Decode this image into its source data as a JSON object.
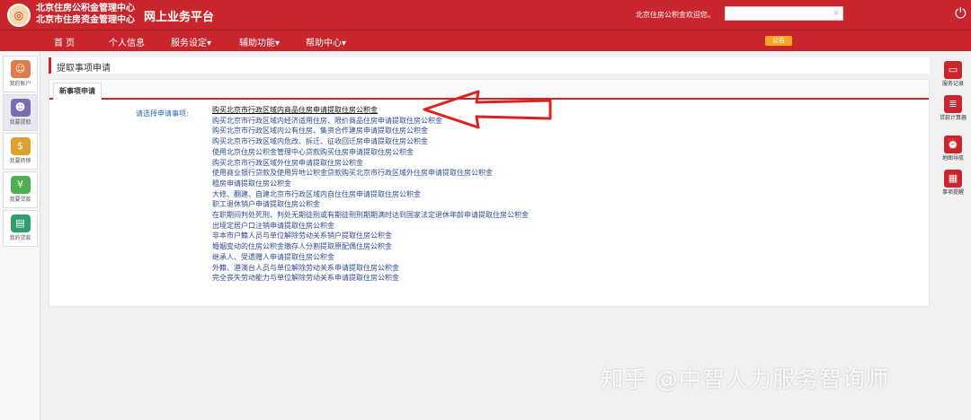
{
  "header": {
    "org_line1": "北京住房公积金管理中心",
    "org_line2": "北京市住房资金管理中心",
    "platform_title": "网上业务平台",
    "welcome": "北京住房公积金欢迎您。",
    "search_value": ""
  },
  "nav": {
    "items": [
      "首 页",
      "个人信息",
      "服务设定▾",
      "辅助功能▾",
      "帮助中心▾"
    ],
    "badge": "公告"
  },
  "leftbar": {
    "items": [
      {
        "label": "我的账户"
      },
      {
        "label": "我要提取"
      },
      {
        "label": "我要转移"
      },
      {
        "label": "我要贷款"
      },
      {
        "label": "我的贷款"
      }
    ]
  },
  "rightbar": {
    "items": [
      {
        "label": "服务记录"
      },
      {
        "label": "贷款计算器"
      },
      {
        "label": "地图导航"
      },
      {
        "label": "事项提醒"
      }
    ]
  },
  "main": {
    "breadcrumb": "提取事项申请",
    "tab": "新事项申请",
    "select_label": "请选择申请事项:",
    "options": [
      "购买北京市行政区域内商品住房申请提取住房公积金",
      "购买北京市行政区域内经济适用住房、限价商品住房申请提取住房公积金",
      "购买北京市行政区域内公有住房、集资合作建房申请提取住房公积金",
      "购买北京市行政区域内危改、拆迁、征收回迁房申请提取住房公积金",
      "使用北京住房公积金管理中心贷款购买住房申请提取住房公积金",
      "购买北京市行政区域外住房申请提取住房公积金",
      "使用商业银行贷款及使用异地公积金贷款购买北京市行政区域外住房申请提取住房公积金",
      "租房申请提取住房公积金",
      "大修、翻建、自建北京市行政区域内自住住房申请提取住房公积金",
      "职工退休销户申请提取住房公积金",
      "在职期间判处死刑、判处无期徒刑或有期徒刑刑期期满时达到国家法定退休年龄申请提取住房公积金",
      "出境定居户口注销申请提取住房公积金",
      "非本市户籍人员与单位解除劳动关系销户提取住房公积金",
      "婚姻变动的住房公积金缴存人分割提取原配偶住房公积金",
      "继承人、受遗赠人申请提取住房公积金",
      "外籍、港澳台人员与单位解除劳动关系申请提取住房公积金",
      "完全丧失劳动能力与单位解除劳动关系申请提取住房公积金"
    ]
  },
  "watermark": "知乎 @中智人力服务智询师",
  "colors": {
    "brand_red": "#c8252c",
    "link_blue": "#2b4c8c",
    "label_blue": "#2b6cb0"
  }
}
